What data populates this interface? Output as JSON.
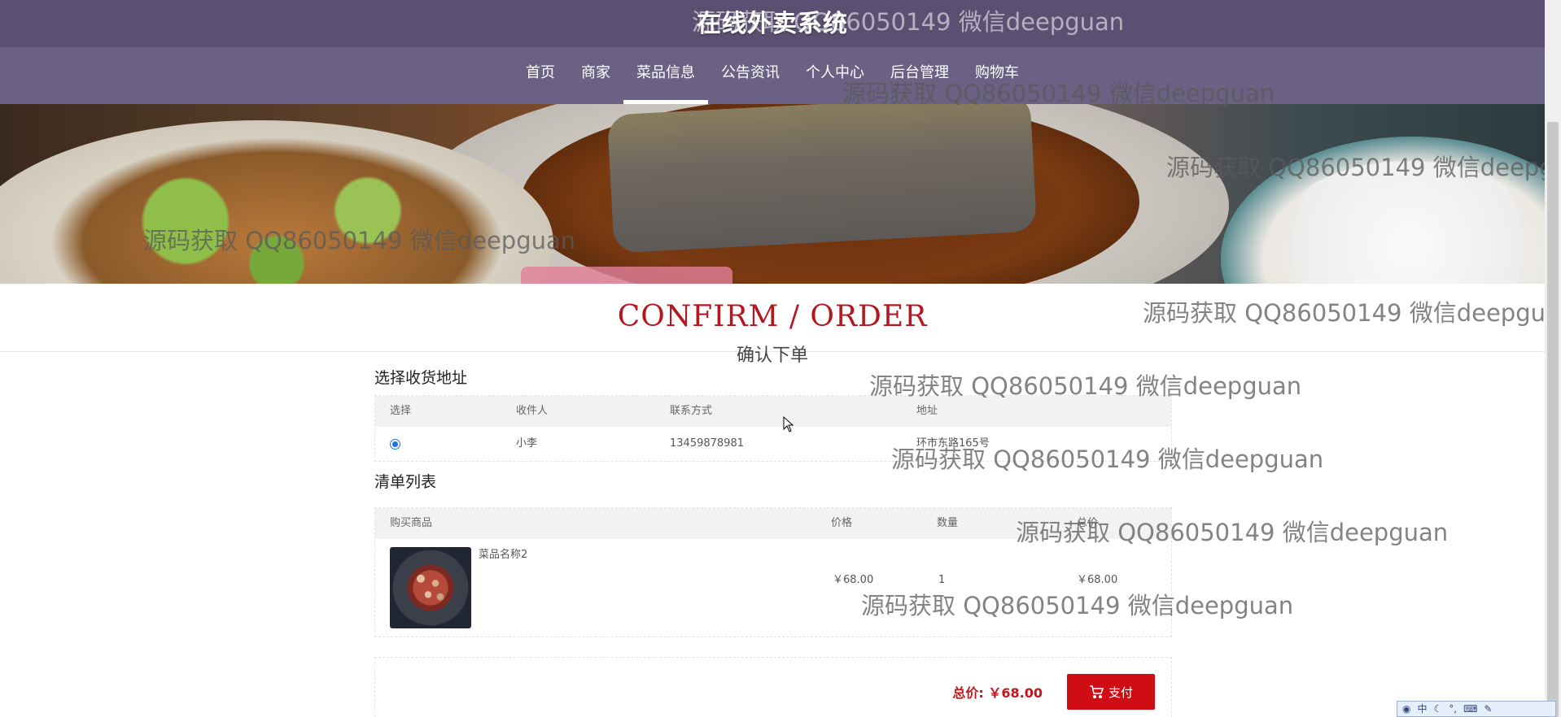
{
  "site": {
    "title": "在线外卖系统"
  },
  "nav": {
    "items": [
      {
        "label": "首页"
      },
      {
        "label": "商家"
      },
      {
        "label": "菜品信息"
      },
      {
        "label": "公告资讯"
      },
      {
        "label": "个人中心"
      },
      {
        "label": "后台管理"
      },
      {
        "label": "购物车"
      }
    ],
    "active": "菜品信息"
  },
  "header": {
    "title": "CONFIRM / ORDER",
    "subtitle": "确认下单"
  },
  "address": {
    "section_label": "选择收货地址",
    "columns": [
      "选择",
      "收件人",
      "联系方式",
      "地址"
    ],
    "rows": [
      {
        "selected": true,
        "recipient": "小李",
        "phone": "13459878981",
        "address": "环市东路165号"
      }
    ]
  },
  "order_list": {
    "section_label": "清单列表",
    "columns": [
      "购买商品",
      "价格",
      "数量",
      "总价"
    ],
    "items": [
      {
        "name": "菜品名称2",
        "price": "￥68.00",
        "quantity": "1",
        "total": "￥68.00"
      }
    ]
  },
  "summary": {
    "total_label": "总价:",
    "total_value": "￥68.00",
    "pay_label": "支付"
  },
  "watermark": "源码获取 QQ86050149 微信deepguan",
  "ime": {
    "lang": "中"
  },
  "colors": {
    "topbar": "#5b4f72",
    "navbar": "#6a6184",
    "accent_red": "#d00c14",
    "title_red": "#b3171f"
  }
}
